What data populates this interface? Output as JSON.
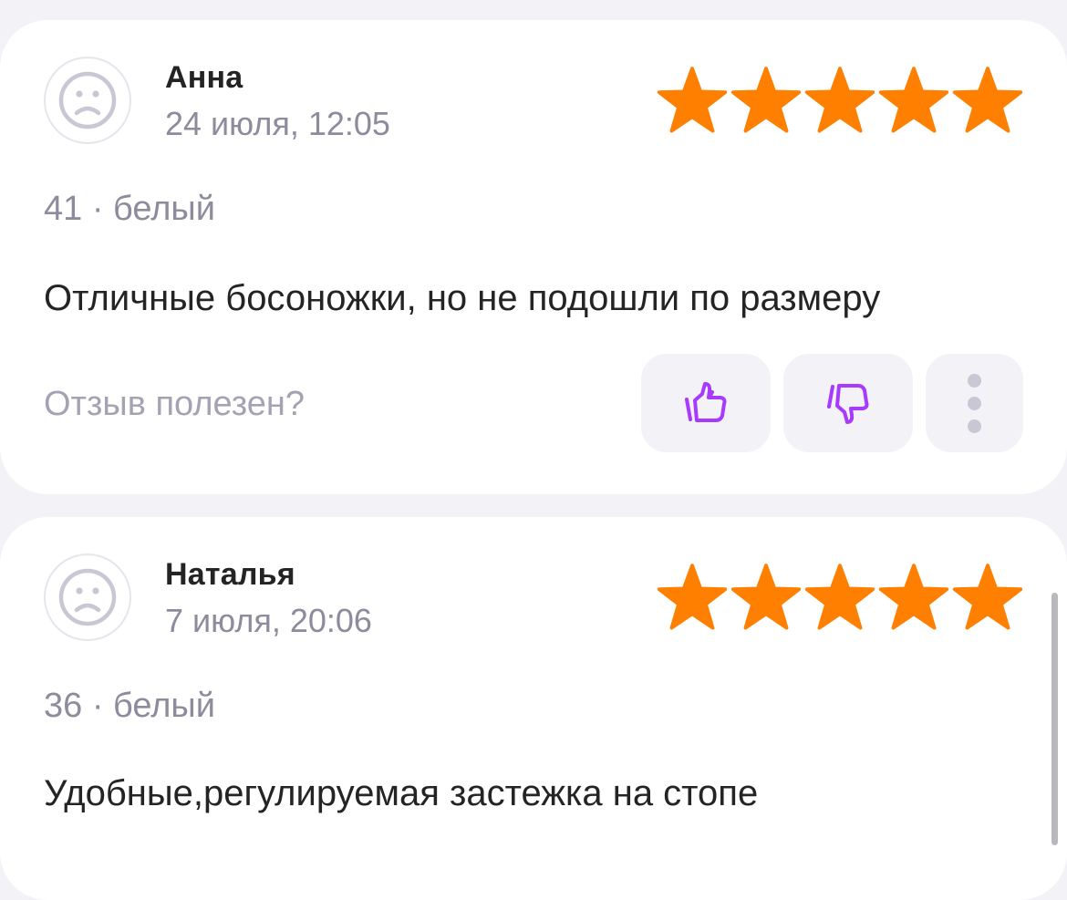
{
  "reviews": [
    {
      "author": "Анна",
      "date": "24 июля, 12:05",
      "rating": 5,
      "variant": "41 · белый",
      "text": "Отличные босоножки, но не подошли по размеру",
      "helpful_prompt": "Отзыв полезен?",
      "avatar_icon": "sad-face-icon",
      "like_icon": "thumbs-up-icon",
      "dislike_icon": "thumbs-down-icon",
      "more_icon": "more-vertical-icon"
    },
    {
      "author": "Наталья",
      "date": "7 июля, 20:06",
      "rating": 5,
      "variant": "36 · белый",
      "text": "Удобные,регулируемая застежка на стопе",
      "avatar_icon": "sad-face-icon"
    }
  ],
  "colors": {
    "background": "#f2f2f7",
    "card": "#ffffff",
    "star": "#ff8000",
    "accent": "#a73afd",
    "primary_text": "#242424",
    "secondary_text": "#8d8b9c",
    "muted_text": "#a5a3b3",
    "button_bg": "#f2f2f7"
  }
}
